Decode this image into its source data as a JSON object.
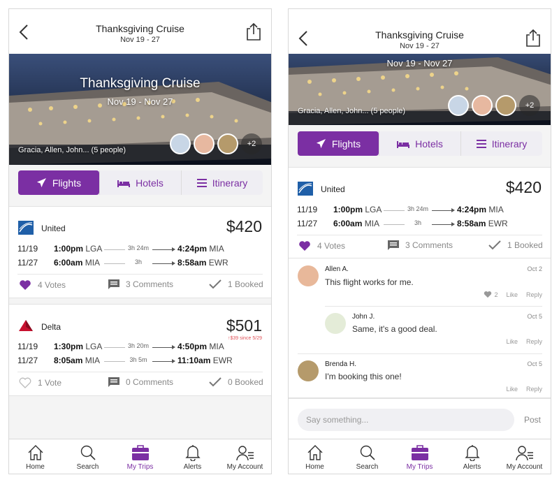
{
  "colors": {
    "accent": "#7b2fa3",
    "price_drop": "#e0545a"
  },
  "left": {
    "header": {
      "title": "Thanksgiving Cruise",
      "dates": "Nov 19 - 27"
    },
    "hero": {
      "title": "Thanksgiving Cruise",
      "dates": "Nov 19 - Nov 27",
      "people": "Gracia, Allen, John... (5 people)",
      "more_count": "+2"
    },
    "tabs": [
      "Flights",
      "Hotels",
      "Itinerary"
    ],
    "cards": [
      {
        "airline": "United",
        "price": "$420",
        "legs": [
          {
            "date": "11/19",
            "dep_time": "1:00pm",
            "dep_code": "LGA",
            "duration": "3h 24m",
            "arr_time": "4:24pm",
            "arr_code": "MIA"
          },
          {
            "date": "11/27",
            "dep_time": "6:00am",
            "dep_code": "MIA",
            "duration": "3h",
            "arr_time": "8:58am",
            "arr_code": "EWR"
          }
        ],
        "votes": "4 Votes",
        "comments": "3 Comments",
        "booked": "1 Booked"
      },
      {
        "airline": "Delta",
        "price": "$501",
        "price_note": "↑$39 since 5/29",
        "legs": [
          {
            "date": "11/19",
            "dep_time": "1:30pm",
            "dep_code": "LGA",
            "duration": "3h 20m",
            "arr_time": "4:50pm",
            "arr_code": "MIA"
          },
          {
            "date": "11/27",
            "dep_time": "8:05am",
            "dep_code": "MIA",
            "duration": "3h 5m",
            "arr_time": "11:10am",
            "arr_code": "EWR"
          }
        ],
        "votes": "1 Vote",
        "comments": "0 Comments",
        "booked": "0 Booked"
      }
    ]
  },
  "right": {
    "header": {
      "title": "Thanksgiving Cruise",
      "dates": "Nov 19 - 27"
    },
    "hero": {
      "dates": "Nov 19 - Nov 27",
      "people": "Gracia, Allen, John... (5 people)",
      "more_count": "+2"
    },
    "tabs": [
      "Flights",
      "Hotels",
      "Itinerary"
    ],
    "card": {
      "airline": "United",
      "price": "$420",
      "legs": [
        {
          "date": "11/19",
          "dep_time": "1:00pm",
          "dep_code": "LGA",
          "duration": "3h 24m",
          "arr_time": "4:24pm",
          "arr_code": "MIA"
        },
        {
          "date": "11/27",
          "dep_time": "6:00am",
          "dep_code": "MIA",
          "duration": "3h",
          "arr_time": "8:58am",
          "arr_code": "EWR"
        }
      ],
      "votes": "4 Votes",
      "comments": "3 Comments",
      "booked": "1 Booked"
    },
    "comments": [
      {
        "name": "Allen A.",
        "text": "This flight works for me.",
        "date": "Oct 2",
        "likes": "2",
        "like": "Like",
        "reply": "Reply"
      },
      {
        "name": "John J.",
        "text": "Same, it's a good deal.",
        "date": "Oct 5",
        "like": "Like",
        "reply": "Reply"
      },
      {
        "name": "Brenda H.",
        "text": "I'm booking this one!",
        "date": "Oct 5",
        "like": "Like",
        "reply": "Reply"
      }
    ],
    "composer": {
      "placeholder": "Say something...",
      "post": "Post"
    }
  },
  "nav": [
    "Home",
    "Search",
    "My Trips",
    "Alerts",
    "My Account"
  ]
}
